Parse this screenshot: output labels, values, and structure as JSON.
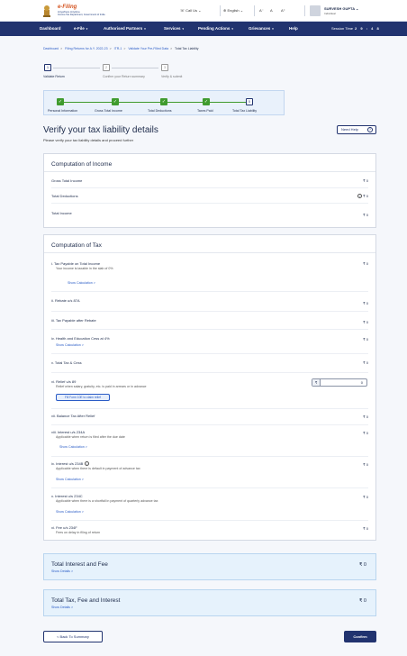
{
  "header": {
    "brand": "e-Filing",
    "brand_sub": "Anywhere Anytime",
    "tagline": "Income Tax Department, Government of India",
    "call_us": "Call Us",
    "language": "English",
    "font_smaller": "A⁻",
    "font_normal": "A",
    "font_larger": "A⁺",
    "user_name": "SURVESH GUPTA",
    "user_type": "Individual"
  },
  "nav": {
    "items": [
      "Dashboard",
      "e-File",
      "Authorised Partners",
      "Services",
      "Pending Actions",
      "Grievances",
      "Help"
    ],
    "session_label": "Session Time",
    "session_time": "2 9 : 4 8"
  },
  "breadcrumb": {
    "items": [
      "Dashboard",
      "Filing Returns for A.Y. 2022-23",
      "ITR-1",
      "Validate Your Pre-Filled Data"
    ],
    "current": "Total Tax Liability"
  },
  "steps": [
    {
      "num": "1",
      "label": "Validate Return"
    },
    {
      "num": "2",
      "label": "Confirm your Return summary"
    },
    {
      "num": "3",
      "label": "Verify & submit"
    }
  ],
  "substeps": [
    {
      "mark": "✓",
      "label": "Personal Information"
    },
    {
      "mark": "✓",
      "label": "Gross Total Income"
    },
    {
      "mark": "✓",
      "label": "Total Deductions"
    },
    {
      "mark": "✓",
      "label": "Taxes Paid"
    },
    {
      "mark": "5",
      "label": "Total Tax Liability"
    }
  ],
  "page": {
    "title": "Verify your tax liability details",
    "subtitle": "Please verify your tax liability details and proceed further",
    "help": "Need Help",
    "help_icon": "?"
  },
  "income": {
    "title": "Computation of Income",
    "rows": [
      {
        "label": "Gross Total Income",
        "value": "₹ 0"
      },
      {
        "label": "Total Deductions",
        "value": "₹ 0"
      },
      {
        "label": "Total Income",
        "value": "₹ 0"
      }
    ]
  },
  "tax": {
    "title": "Computation of Tax",
    "rows": [
      {
        "label": "i. Tax Payable on Total Income",
        "desc": "Your income is taxable in the slab of 0%",
        "link": "Show Calculation >",
        "value": "₹ 0"
      },
      {
        "label": "ii. Rebate u/s 87A",
        "value": "₹ 0"
      },
      {
        "label": "iii. Tax Payable after Rebate",
        "value": "₹ 0"
      },
      {
        "label": "iv. Health and Education Cess at 4%",
        "link": "Show Calculation >",
        "value": "₹ 0"
      },
      {
        "label": "v. Total Tax & Cess",
        "value": "₹ 0"
      },
      {
        "label": "vi. Relief u/s 89",
        "desc": "Relief when salary, gratuity, etc. is paid in arrears or in advance",
        "button": "Fill Form 10E to claim relief",
        "input_prefix": "₹",
        "input_value": "0"
      },
      {
        "label": "vii. Balance Tax After Relief",
        "value": "₹ 0"
      },
      {
        "label": "viii. Interest u/s 234A",
        "desc": "Applicable when return is filed after the due date",
        "link": "Show Calculation >",
        "value": "₹ 0"
      },
      {
        "label": "ix. Interest u/s 234B",
        "desc": "Applicable when there is default in payment of advance tax",
        "link": "Show Calculation >",
        "value": "₹ 0"
      },
      {
        "label": "x. Interest u/s 234C",
        "desc": "Applicable when there is a shortfall in payment of quarterly advance tax",
        "link": "Show Calculation >",
        "value": "₹ 0"
      },
      {
        "label": "xi. Fee u/s 234F",
        "desc": "Fees on delay in filing of return",
        "value": "₹ 0"
      }
    ]
  },
  "summaries": [
    {
      "title": "Total Interest and Fee",
      "link": "Show Details >",
      "value": "₹ 0"
    },
    {
      "title": "Total Tax, Fee and Interest",
      "link": "Show Details >",
      "value": "₹ 0"
    }
  ],
  "footer": {
    "back": "< Back To Summary",
    "confirm": "Confirm"
  },
  "colors": {
    "navbar": "#21336f",
    "link": "#2a5cc6",
    "step_done": "#3f9b2e",
    "summary_bg": "#e6f2fc"
  }
}
